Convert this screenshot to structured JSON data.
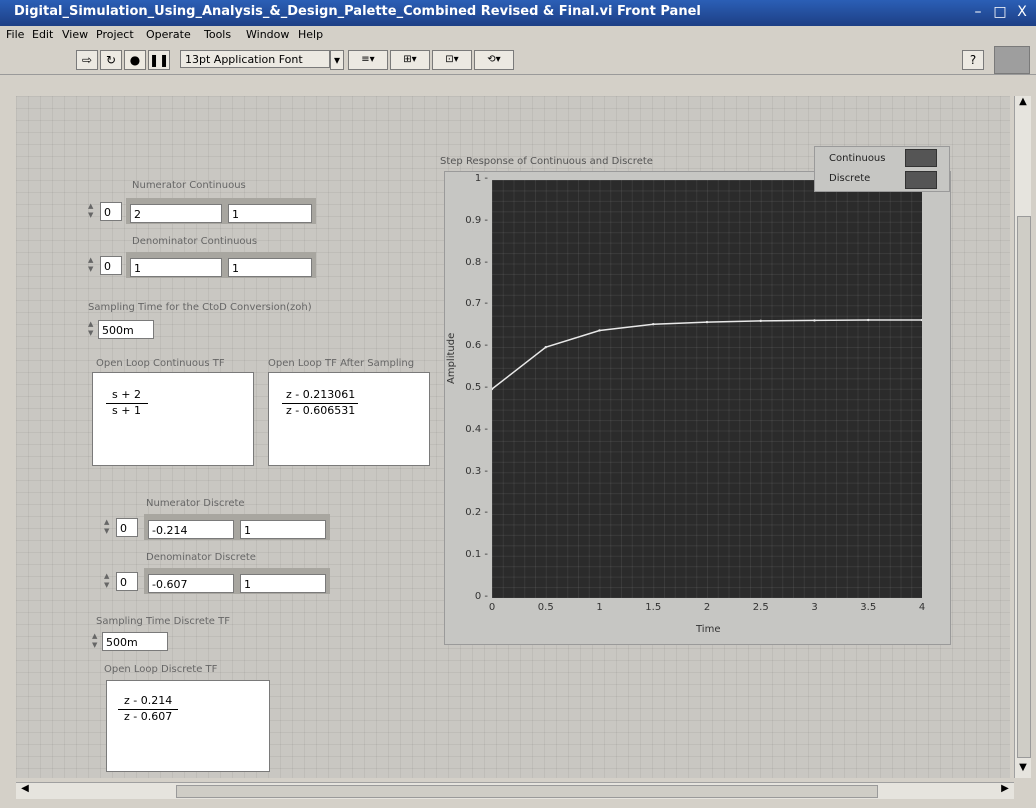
{
  "window": {
    "title": "Digital_Simulation_Using_Analysis_&_Design_Palette_Combined Revised & Final.vi Front Panel",
    "minimize": "–",
    "maximize": "□",
    "close": "X"
  },
  "menu": [
    "File",
    "Edit",
    "View",
    "Project",
    "Operate",
    "Tools",
    "Window",
    "Help"
  ],
  "toolbar": {
    "font": "13pt Application Font",
    "help": "?"
  },
  "controls": {
    "num_cont": {
      "label": "Numerator Continuous",
      "index": "0",
      "values": [
        "2",
        "1"
      ]
    },
    "den_cont": {
      "label": "Denominator Continuous",
      "index": "0",
      "values": [
        "1",
        "1"
      ]
    },
    "sampling_c2d": {
      "label": "Sampling Time for the CtoD Conversion(zoh)",
      "value": "500m"
    },
    "ol_cont_tf": {
      "label": "Open Loop Continuous TF",
      "num": "s + 2",
      "den": "s + 1"
    },
    "ol_after_sampling": {
      "label": "Open Loop TF After Sampling",
      "num": "z - 0.213061",
      "den": "z - 0.606531"
    },
    "num_disc": {
      "label": "Numerator Discrete",
      "index": "0",
      "values": [
        "-0.214",
        "1"
      ]
    },
    "den_disc": {
      "label": "Denominator Discrete",
      "index": "0",
      "values": [
        "-0.607",
        "1"
      ]
    },
    "sampling_disc": {
      "label": "Sampling Time Discrete TF",
      "value": "500m"
    },
    "ol_disc_tf": {
      "label": "Open Loop Discrete TF",
      "num": "z - 0.214",
      "den": "z - 0.607"
    }
  },
  "legend": {
    "items": [
      {
        "name": "Continuous"
      },
      {
        "name": "Discrete"
      }
    ]
  },
  "chart_data": {
    "type": "line",
    "title": "Step Response of Continuous and Discrete",
    "xlabel": "Time",
    "ylabel": "Amplitude",
    "xlim": [
      0,
      4
    ],
    "ylim": [
      0,
      1
    ],
    "xticks": [
      "0",
      "0.5",
      "1",
      "1.5",
      "2",
      "2.5",
      "3",
      "3.5",
      "4"
    ],
    "yticks": [
      "0",
      "0.1",
      "0.2",
      "0.3",
      "0.4",
      "0.5",
      "0.6",
      "0.7",
      "0.8",
      "0.9",
      "1"
    ],
    "series": [
      {
        "name": "Continuous",
        "x": [
          0,
          0.5,
          1,
          1.5,
          2,
          2.5,
          3,
          3.5,
          4
        ],
        "values": [
          0.5,
          0.6,
          0.64,
          0.655,
          0.66,
          0.663,
          0.664,
          0.665,
          0.665
        ]
      }
    ]
  }
}
